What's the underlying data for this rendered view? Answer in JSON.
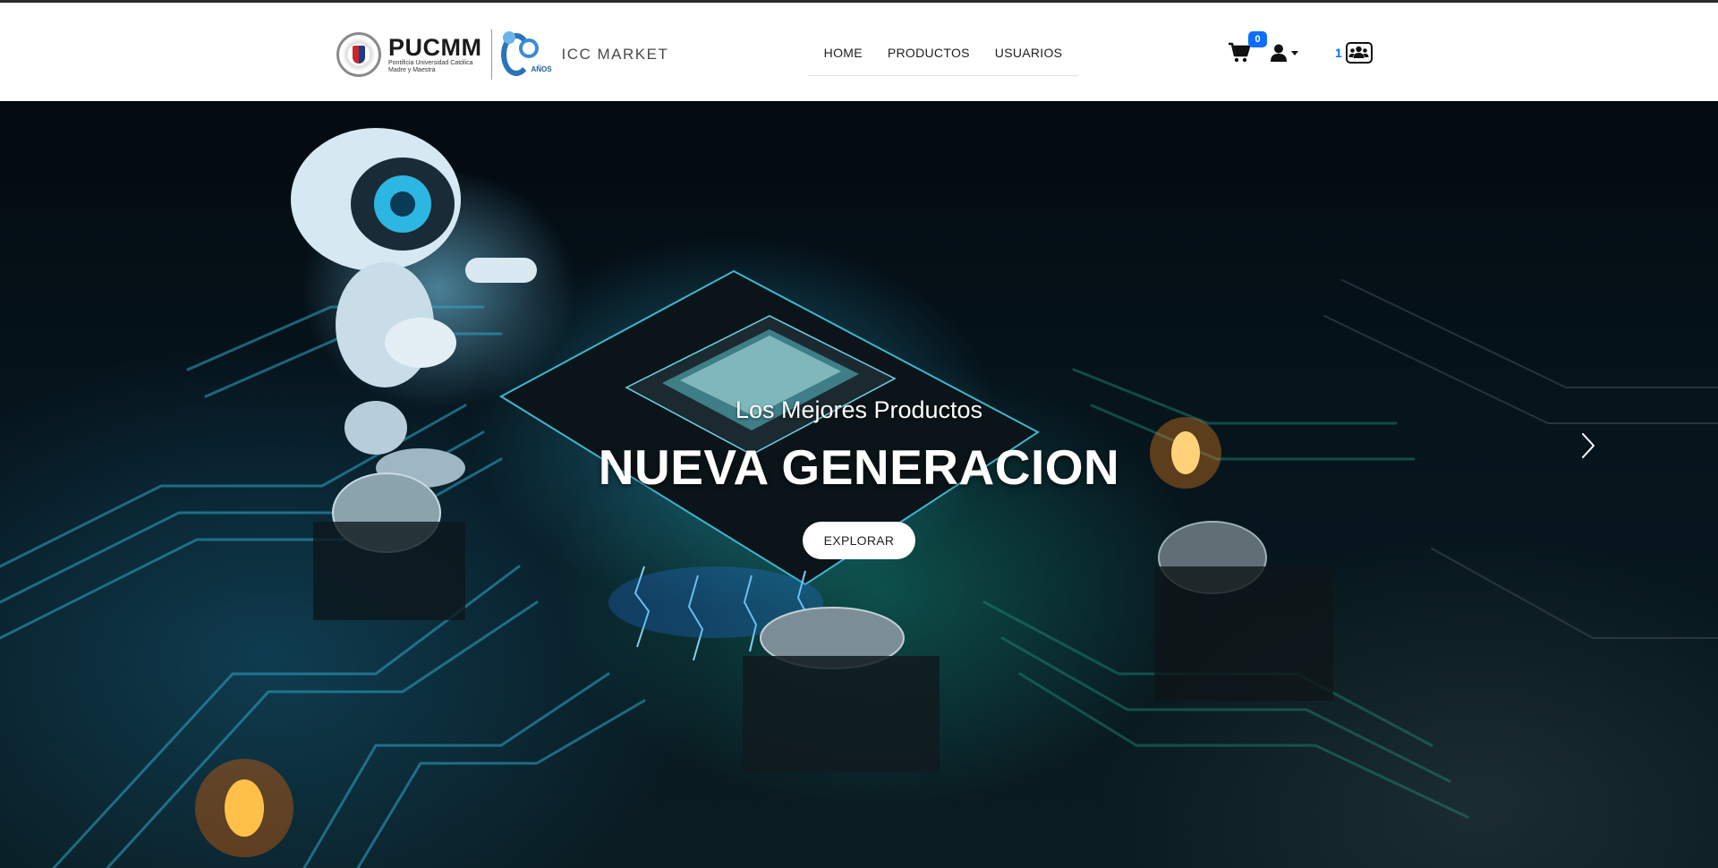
{
  "brand": {
    "university_name": "PUCMM",
    "university_subtitle_line1": "Pontificia Universidad Católica",
    "university_subtitle_line2": "Madre y Maestra",
    "anniversary_word": "AÑOS",
    "store_name": "ICC MARKET"
  },
  "nav": {
    "items": [
      {
        "label": "HOME"
      },
      {
        "label": "PRODUCTOS"
      },
      {
        "label": "USUARIOS"
      }
    ]
  },
  "cart": {
    "count": "0"
  },
  "groups": {
    "count": "1"
  },
  "hero": {
    "subtitle": "Los Mejores Productos",
    "title": "NUEVA GENERACION",
    "cta_label": "EXPLORAR"
  },
  "icons": {
    "cart": "cart-icon",
    "user": "user-icon",
    "group": "users-group-icon",
    "next": "chevron-right-icon"
  },
  "colors": {
    "accent": "#0d6efd",
    "header_bg": "#ffffff",
    "hero_dark": "#06141c",
    "glow_cyan": "#5ad2ff",
    "glow_teal": "#1ea38a"
  }
}
